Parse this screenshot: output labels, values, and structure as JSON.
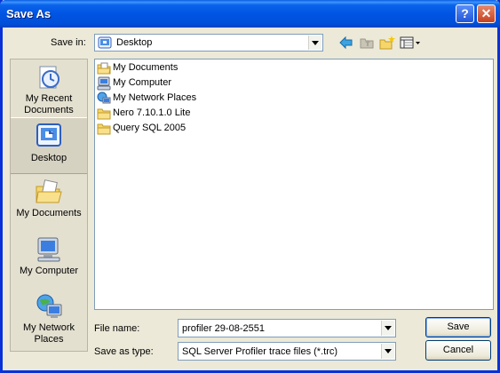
{
  "window": {
    "title": "Save As"
  },
  "titlebar_buttons": {
    "help": "?",
    "close": "✕"
  },
  "location": {
    "label": "Save in:",
    "value": "Desktop",
    "icon": "desktop-icon"
  },
  "toolbar": [
    {
      "name": "back-button",
      "icon": "back-arrow-icon"
    },
    {
      "name": "up-folder-button",
      "icon": "up-folder-icon"
    },
    {
      "name": "new-folder-button",
      "icon": "new-folder-icon"
    },
    {
      "name": "views-menu-button",
      "icon": "views-icon"
    }
  ],
  "places": [
    {
      "label": "My Recent Documents",
      "icon": "recent-documents-icon",
      "selected": false
    },
    {
      "label": "Desktop",
      "icon": "desktop-icon",
      "selected": true
    },
    {
      "label": "My Documents",
      "icon": "my-documents-icon",
      "selected": false
    },
    {
      "label": "My Computer",
      "icon": "my-computer-icon",
      "selected": false
    },
    {
      "label": "My Network Places",
      "icon": "network-places-icon",
      "selected": false
    }
  ],
  "files": [
    {
      "name": "My Documents",
      "icon": "my-documents-icon"
    },
    {
      "name": "My Computer",
      "icon": "my-computer-icon"
    },
    {
      "name": "My Network Places",
      "icon": "network-places-icon"
    },
    {
      "name": "Nero 7.10.1.0 Lite",
      "icon": "folder-icon"
    },
    {
      "name": "Query SQL 2005",
      "icon": "folder-icon"
    }
  ],
  "filename": {
    "label": "File name:",
    "value": "profiler 29-08-2551"
  },
  "filetype": {
    "label": "Save as type:",
    "value": "SQL Server Profiler trace files (*.trc)"
  },
  "buttons": {
    "save": "Save",
    "cancel": "Cancel"
  },
  "colors": {
    "titlebar": "#0054e3",
    "dialog_bg": "#ece9d8",
    "folder": "#f5d66b"
  }
}
